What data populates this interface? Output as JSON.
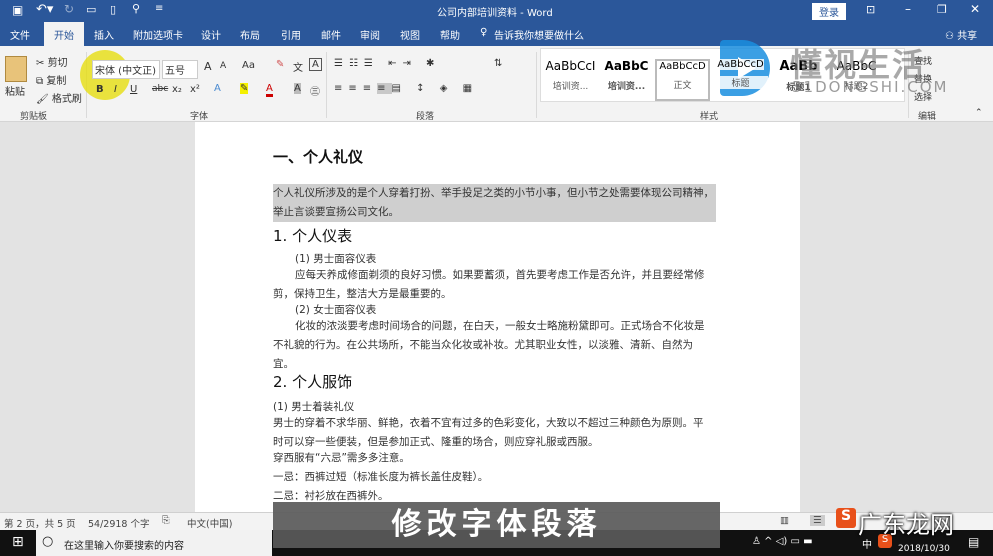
{
  "title": "公司内部培训资料 - Word",
  "signin": "登录",
  "tabs": [
    "文件",
    "开始",
    "插入",
    "附加选项卡",
    "设计",
    "布局",
    "引用",
    "邮件",
    "审阅",
    "视图",
    "帮助"
  ],
  "tell_me": "告诉我你想要做什么",
  "share": "共享",
  "clipboard": {
    "paste": "粘贴",
    "cut": "剪切",
    "copy": "复制",
    "format_painter": "格式刷",
    "group": "剪贴板"
  },
  "font": {
    "name": "宋体 (中文正)",
    "size": "五号",
    "group": "字体",
    "grow": "A",
    "shrink": "A",
    "case": "Aa",
    "bold": "B",
    "italic": "I",
    "underline": "U",
    "strike": "abc",
    "sub": "x₂",
    "sup": "x²"
  },
  "paragraph": {
    "group": "段落"
  },
  "styles": {
    "group": "样式",
    "items": [
      {
        "preview": "AaBbCcI",
        "name": "培训资..."
      },
      {
        "preview": "AaBbC",
        "name": "培训资..."
      },
      {
        "preview": "AaBbCcD",
        "name": "正文"
      },
      {
        "preview": "AaBbCcD",
        "name": "标题"
      },
      {
        "preview": "AaBb",
        "name": "标题1"
      },
      {
        "preview": "AaBbC",
        "name": "标题2"
      }
    ]
  },
  "editing": {
    "group": "编辑",
    "find": "查找",
    "replace": "替换",
    "select": "选择"
  },
  "watermark": {
    "brand": "懂视生活",
    "url": "51DONGSHI.COM",
    "site": "广东龙网"
  },
  "doc": {
    "h1": "一、个人礼仪",
    "intro": "个人礼仪所涉及的是个人穿着打扮、举手投足之类的小节小事，但小节之处需要体现公司精神，举止言谈要宣扬公司文化。",
    "s1": "1. 个人仪表",
    "s1a": "(1) 男士面容仪表",
    "s1a_text": "应每天养成修面剃须的良好习惯。如果要蓄须，首先要考虑工作是否允许，并且要经常修剪，保持卫生，整洁大方是最重要的。",
    "s1b": "(2) 女士面容仪表",
    "s1b_text": "化妆的浓淡要考虑时间场合的问题，在白天，一般女士略施粉黛即可。正式场合不化妆是不礼貌的行为。在公共场所，不能当众化妆或补妆。尤其职业女性，以淡雅、清新、自然为宜。",
    "s2": "2. 个人服饰",
    "s2a": "(1) 男士着装礼仪",
    "s2a_text": "男士的穿着不求华丽、鲜艳，衣着不宜有过多的色彩变化，大致以不超过三种颜色为原则。平时可以穿一些便装，但是参加正式、隆重的场合，则应穿礼服或西服。",
    "l1": "穿西服有“六忌”需多多注意。",
    "l2": "一忌：西裤过短（标准长度为裤长盖住皮鞋）。",
    "l3": "二忌：衬衫放在西裤外。"
  },
  "status": {
    "page": "第 2 页，共 5 页",
    "words": "54/2918 个字",
    "lang": "中文(中国)"
  },
  "taskbar": {
    "search": "在这里输入你要搜索的内容",
    "ime": "中",
    "date": "2018/10/30"
  },
  "subtitle": "修改字体段落"
}
